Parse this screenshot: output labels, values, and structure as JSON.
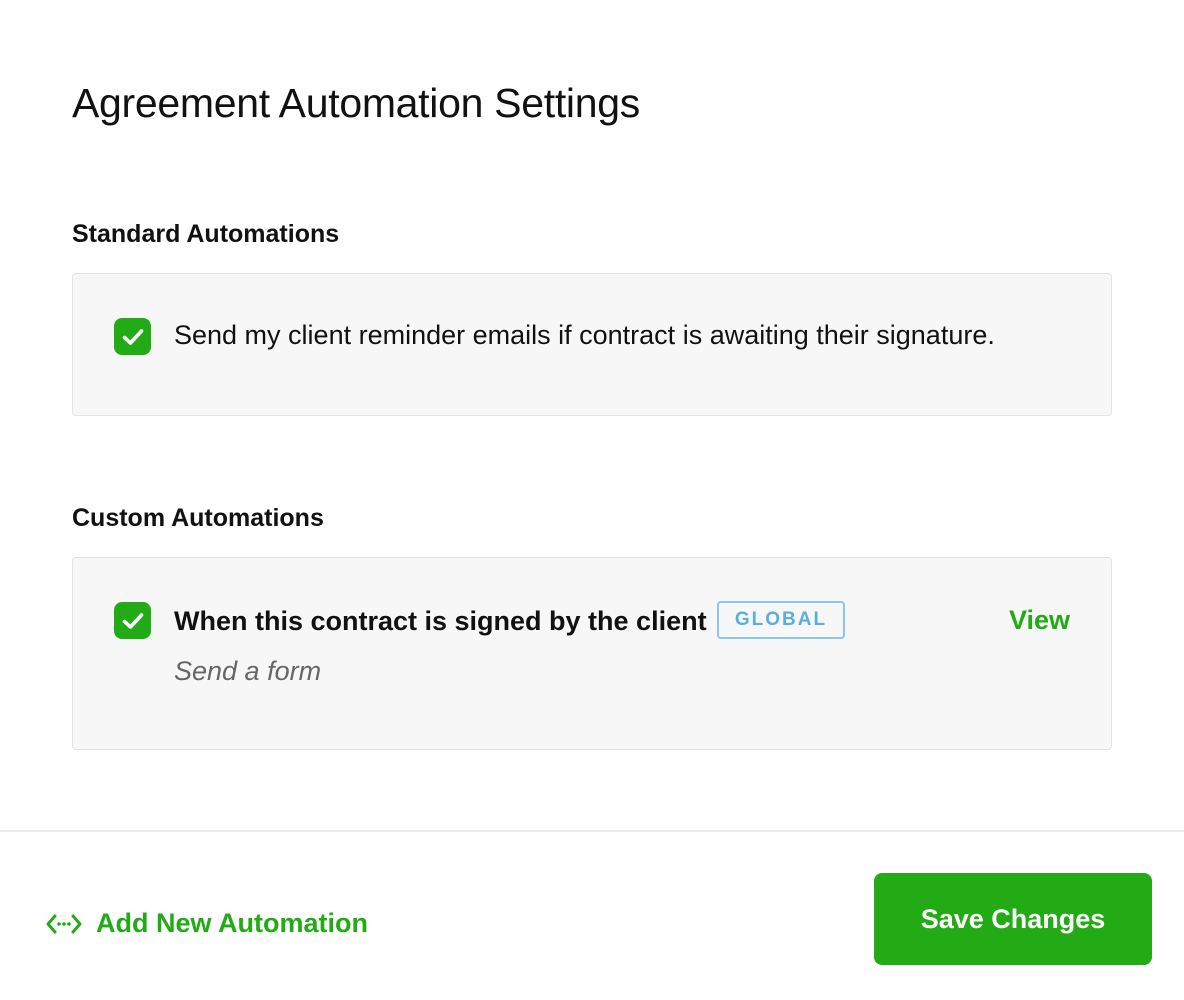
{
  "modal": {
    "title": "Agreement Automation Settings"
  },
  "standard": {
    "heading": "Standard Automations",
    "items": [
      {
        "checked": true,
        "label": "Send my client reminder emails if contract is awaiting their signature."
      }
    ]
  },
  "custom": {
    "heading": "Custom Automations",
    "items": [
      {
        "checked": true,
        "title": "When this contract is signed by the client",
        "badge": "GLOBAL",
        "action_text": "Send a form",
        "view_label": "View"
      }
    ]
  },
  "footer": {
    "add_label": "Add New Automation",
    "add_icon": "add-automation-icon",
    "save_label": "Save Changes"
  },
  "colors": {
    "accent": "#22ab15",
    "badge": "#5aaee0",
    "panel_bg": "#f7f7f7"
  }
}
